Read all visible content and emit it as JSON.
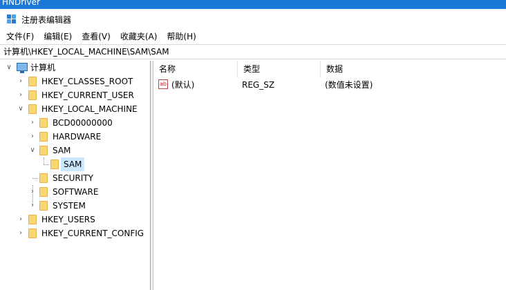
{
  "taskbar": {
    "text": "HNDriver"
  },
  "window": {
    "title": "注册表编辑器",
    "app_icon": "regedit-icon"
  },
  "menu": {
    "items": [
      "文件(F)",
      "编辑(E)",
      "查看(V)",
      "收藏夹(A)",
      "帮助(H)"
    ]
  },
  "address": {
    "path": "计算机\\HKEY_LOCAL_MACHINE\\SAM\\SAM"
  },
  "tree": {
    "root": "计算机",
    "hives": [
      "HKEY_CLASSES_ROOT",
      "HKEY_CURRENT_USER",
      "HKEY_LOCAL_MACHINE",
      "HKEY_USERS",
      "HKEY_CURRENT_CONFIG"
    ],
    "hklm_children": [
      "BCD00000000",
      "HARDWARE",
      "SAM",
      "SECURITY",
      "SOFTWARE",
      "SYSTEM"
    ],
    "sam_children": [
      "SAM"
    ],
    "selected": "SAM"
  },
  "list": {
    "columns": [
      "名称",
      "类型",
      "数据"
    ],
    "rows": [
      {
        "name": "(默认)",
        "type": "REG_SZ",
        "data": "(数值未设置)",
        "icon": "string-value-icon"
      }
    ]
  },
  "colors": {
    "selection": "#cce8ff",
    "folder": "#f7d674",
    "taskbar": "#1a78d6"
  }
}
